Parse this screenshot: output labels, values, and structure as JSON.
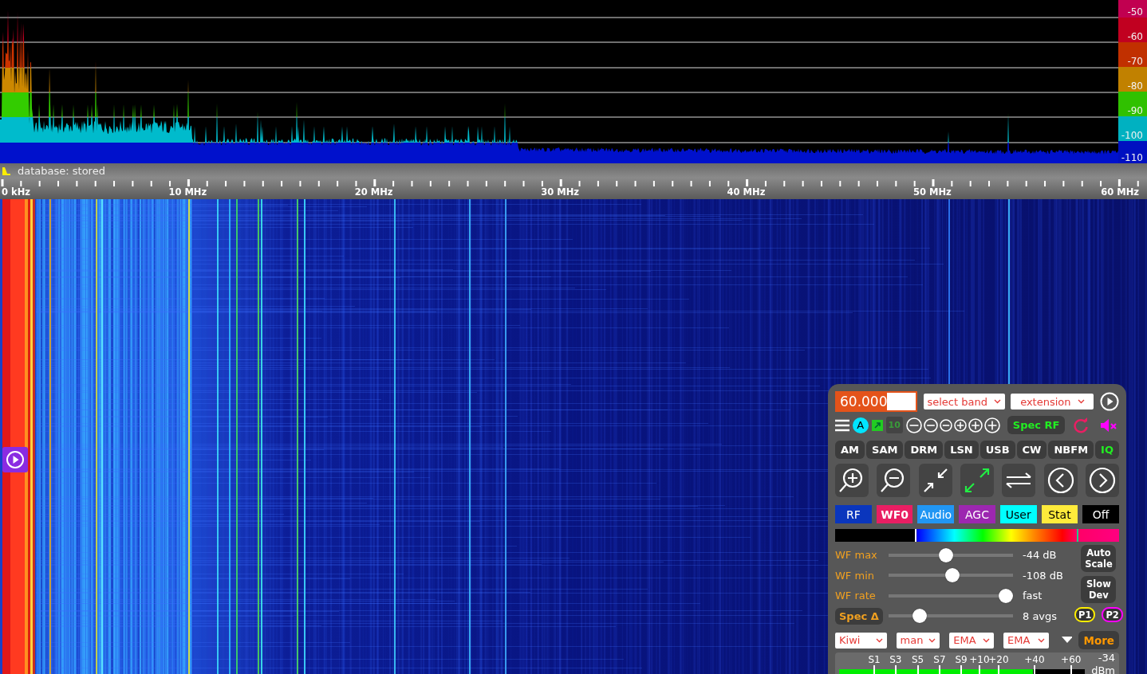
{
  "spectrum": {
    "scale": [
      {
        "label": "-50",
        "color": "#cc0055"
      },
      {
        "label": "-60",
        "color": "#cc0022"
      },
      {
        "label": "-70",
        "color": "#cc3300"
      },
      {
        "label": "-80",
        "color": "#cc8800"
      },
      {
        "label": "-90",
        "color": "#33cc00"
      },
      {
        "label": "-100",
        "color": "#00bbcc"
      },
      {
        "label": "-110",
        "color": "#0011cc"
      }
    ]
  },
  "frequency_axis": {
    "status": "database: stored",
    "labels": [
      "0 kHz",
      "10 MHz",
      "20 MHz",
      "30 MHz",
      "40 MHz",
      "50 MHz",
      "60 MHz"
    ]
  },
  "control_panel": {
    "frequency": {
      "value": "60.000"
    },
    "band_select": {
      "value": "select band"
    },
    "extension_select": {
      "value": "extension"
    },
    "channel_badge": "A",
    "signal_count": "10",
    "spec_button": "Spec RF",
    "modes": [
      {
        "label": "AM",
        "selected": false
      },
      {
        "label": "SAM",
        "selected": false
      },
      {
        "label": "DRM",
        "selected": false
      },
      {
        "label": "LSN",
        "selected": false
      },
      {
        "label": "USB",
        "selected": false
      },
      {
        "label": "CW",
        "selected": false
      },
      {
        "label": "NBFM",
        "selected": false
      },
      {
        "label": "IQ",
        "selected": true
      }
    ],
    "tabs": [
      {
        "label": "RF",
        "color": "#0a36bd",
        "selected": false
      },
      {
        "label": "WF0",
        "color": "#e91e63",
        "selected": true
      },
      {
        "label": "Audio",
        "color": "#2196f3",
        "selected": false
      },
      {
        "label": "AGC",
        "color": "#9c27b0",
        "selected": false
      },
      {
        "label": "User",
        "color": "#00ffff",
        "selected": false
      },
      {
        "label": "Stat",
        "color": "#ffeb3b",
        "selected": false
      },
      {
        "label": "Off",
        "color": "#000000",
        "selected": false
      }
    ],
    "sliders": [
      {
        "kind": "label",
        "label": "WF max",
        "level": 0.46,
        "reading": "-44 dB"
      },
      {
        "kind": "label",
        "label": "WF min",
        "level": 0.51,
        "reading": "-108 dB"
      },
      {
        "kind": "label",
        "label": "WF rate",
        "level": 0.94,
        "reading": "fast"
      },
      {
        "kind": "button",
        "label": "Spec Δ",
        "level": 0.25,
        "reading": "8 avgs"
      }
    ],
    "side_buttons": [
      "Auto Scale",
      "Slow Dev"
    ],
    "presets": [
      {
        "label": "P1",
        "color": "#ffee00"
      },
      {
        "label": "P2",
        "color": "#ff00ff"
      }
    ],
    "dropdowns": [
      "Kiwi",
      "man",
      "EMA",
      "EMA"
    ],
    "more_button": "More",
    "s_meter": {
      "labels": [
        "S1",
        "S3",
        "S5",
        "S7",
        "S9",
        "+10",
        "+20",
        "+40",
        "+60"
      ],
      "level": 0.79,
      "reading": "-34",
      "unit": "dBm"
    }
  }
}
